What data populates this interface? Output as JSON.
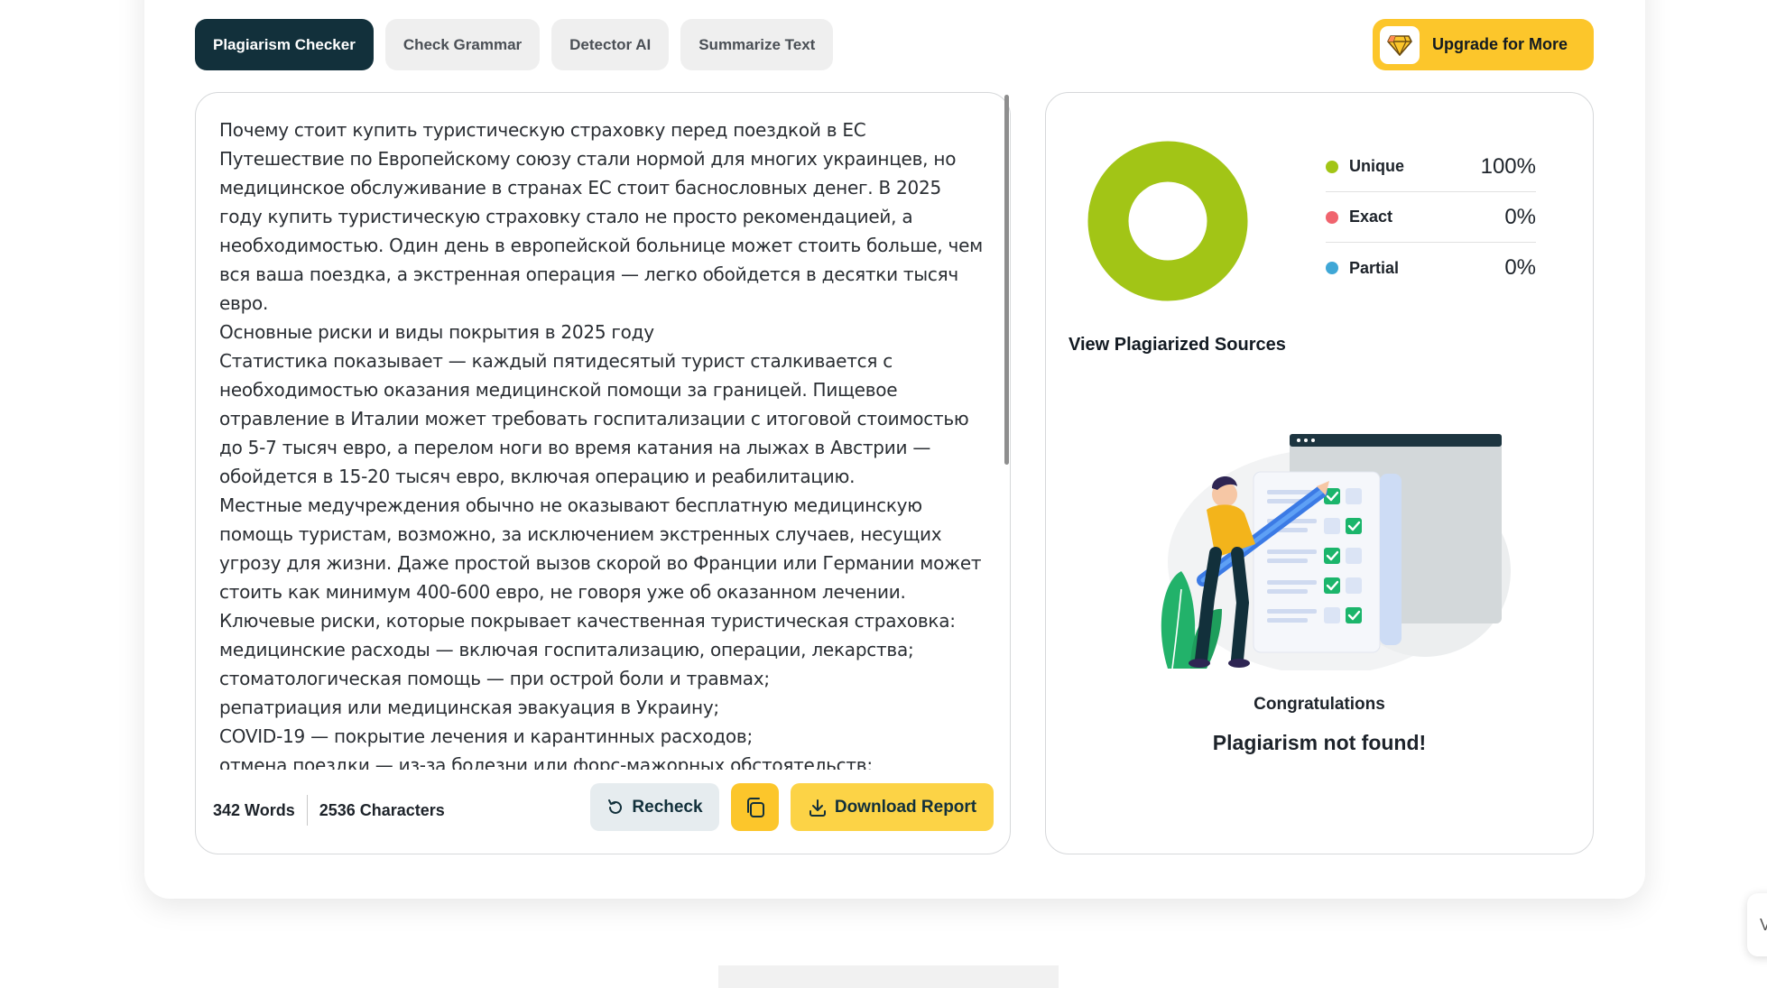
{
  "tabs": [
    {
      "label": "Plagiarism Checker",
      "active": true
    },
    {
      "label": "Check Grammar",
      "active": false
    },
    {
      "label": "Detector AI",
      "active": false
    },
    {
      "label": "Summarize Text",
      "active": false
    }
  ],
  "upgrade": {
    "label": "Upgrade for More",
    "icon": "diamond-icon"
  },
  "editor": {
    "paragraphs": [
      "Почему стоит купить туристическую страховку перед поездкой в ЕС",
      "Путешествие по Европейскому союзу стали нормой для многих украинцев, но медицинское обслуживание в странах ЕС стоит баснословных денег. В 2025 году купить туристическую страховку стало не просто рекомендацией, а необходимостью. Один день в европейской больнице может стоить больше, чем вся ваша поездка, а экстренная операция — легко обойдется в десятки тысяч евро.",
      "Основные риски и виды покрытия в 2025 году",
      "Статистика показывает — каждый пятидесятый турист сталкивается с необходимостью оказания медицинской помощи за границей. Пищевое отравление в Италии может требовать госпитализации с итоговой стоимостью до 5-7 тысяч евро, а перелом ноги во время катания на лыжах в Австрии — обойдется в 15-20 тысяч евро, включая операцию и реабилитацию.",
      "Местные медучреждения обычно не оказывают бесплатную медицинскую помощь туристам, возможно, за исключением экстренных случаев, несущих угрозу для жизни. Даже простой вызов скорой во Франции или Германии может стоить как минимум 400-600 евро, не говоря уже об оказанном лечении.",
      "Ключевые риски, которые покрывает качественная туристическая страховка:",
      "медицинские расходы — включая госпитализацию, операции, лекарства;",
      "стоматологическая помощь — при острой боли и травмах;",
      "репатриация или медицинская эвакуация в Украину;",
      "COVID-19 — покрытие лечения и карантинных расходов;",
      "отмена поездки — из-за болезни или форс-мажорных обстоятельств;"
    ],
    "words": "342 Words",
    "characters": "2536 Characters",
    "recheck_label": "Recheck",
    "download_label": "Download Report"
  },
  "results": {
    "legend": [
      {
        "label": "Unique",
        "value": "100%",
        "color": "#a2c516"
      },
      {
        "label": "Exact",
        "value": "0%",
        "color": "#f0646e"
      },
      {
        "label": "Partial",
        "value": "0%",
        "color": "#3fa7d6"
      }
    ],
    "unique_fraction": 1.0,
    "sources_title": "View Plagiarized Sources",
    "congrats": "Congratulations",
    "not_found": "Plagiarism not found!"
  },
  "side_widget": {
    "text": "V"
  }
}
